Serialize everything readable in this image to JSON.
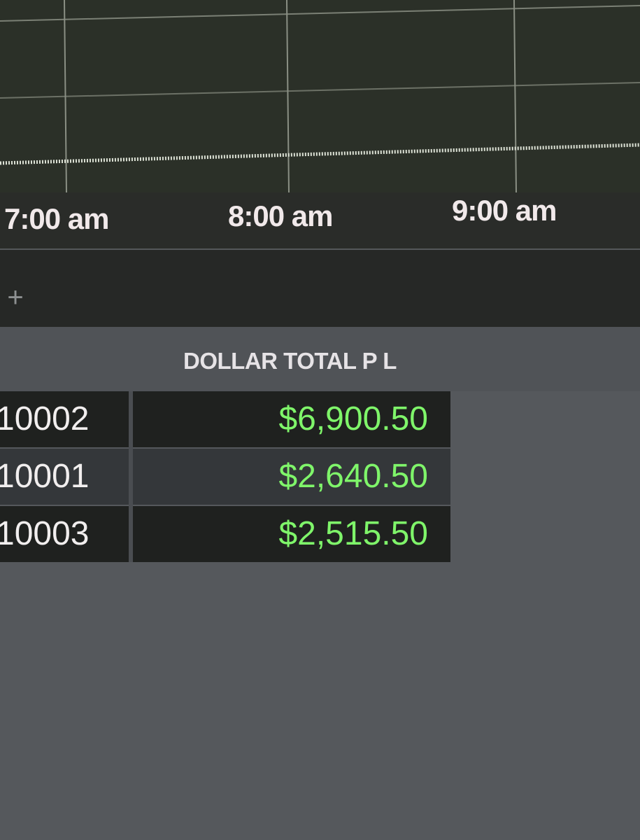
{
  "chart": {
    "time_axis": {
      "labels": [
        "7:00 am",
        "8:00 am",
        "9:00 am"
      ]
    }
  },
  "toolbar": {
    "add_tab_label": "+"
  },
  "grid": {
    "columns": [
      "",
      "DOLLAR TOTAL P L"
    ],
    "rows": [
      {
        "id": "10002",
        "dollar_total_pl": "$6,900.50"
      },
      {
        "id": "10001",
        "dollar_total_pl": "$2,640.50"
      },
      {
        "id": "10003",
        "dollar_total_pl": "$2,515.50"
      }
    ]
  },
  "colors": {
    "positive_pl": "#7ff56a",
    "chart_background": "#2b3028",
    "series_line": "#d8ddd2"
  }
}
